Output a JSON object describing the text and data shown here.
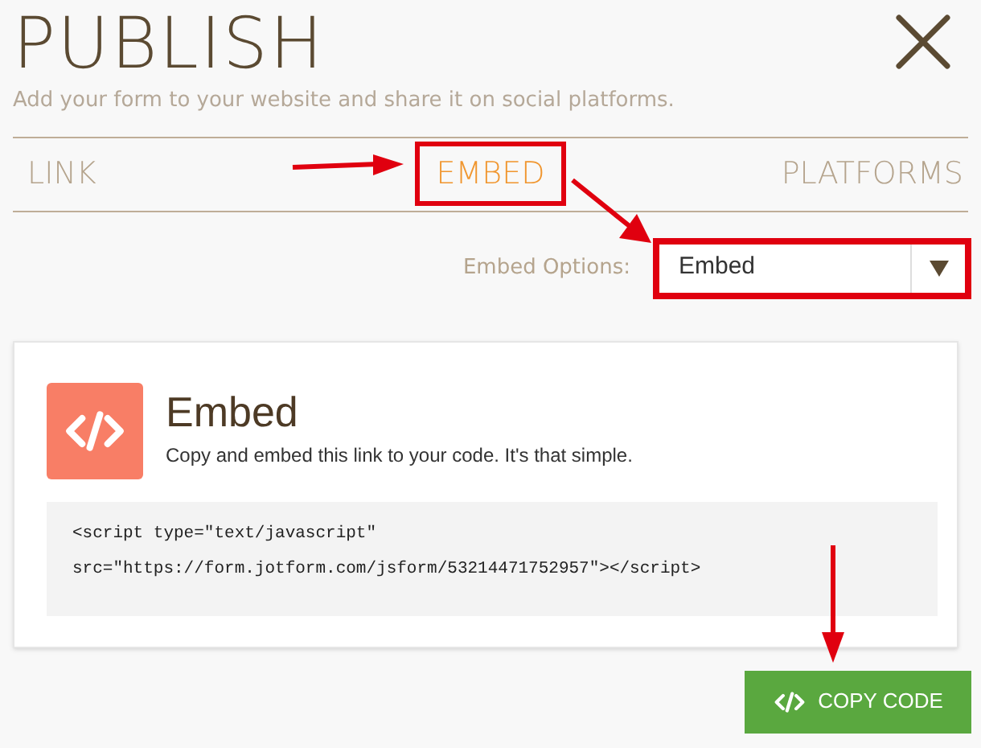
{
  "title": "PUBLISH",
  "subtitle": "Add your form to your website and share it on social platforms.",
  "tabs": [
    {
      "label": "LINK",
      "selected": false
    },
    {
      "label": "EMBED",
      "selected": true
    },
    {
      "label": "PLATFORMS",
      "selected": false
    }
  ],
  "embed_options": {
    "label": "Embed Options:",
    "value": "Embed"
  },
  "card": {
    "title": "Embed",
    "description": "Copy and embed this link to your code. It's that simple.",
    "code_lines": [
      "<script type=\"text/javascript\"",
      "src=\"https://form.jotform.com/jsform/53214471752957\"></script>"
    ]
  },
  "copy_button": "COPY CODE"
}
